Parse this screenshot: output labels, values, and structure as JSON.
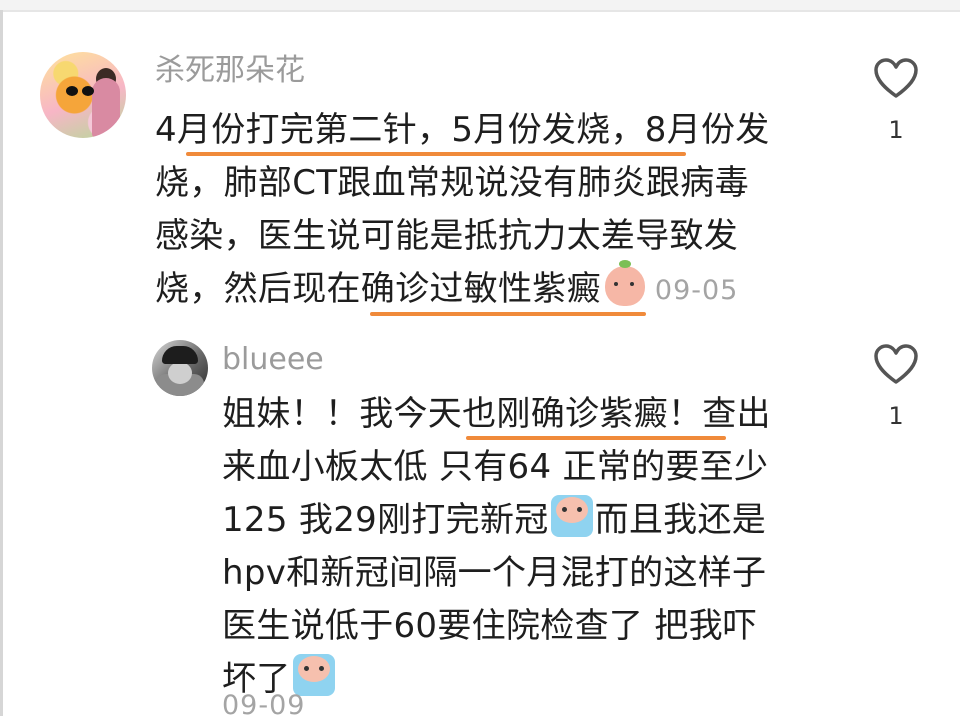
{
  "comments": [
    {
      "username": "杀死那朵花",
      "lines": [
        "4月份打完第二针，5月份发烧，8月份发",
        "烧，肺部CT跟血常规说没有肺炎跟病毒",
        "感染，医生说可能是抵抗力太差导致发",
        "烧，然后现在确诊过敏性紫癜"
      ],
      "date": "09-05",
      "likes": "1",
      "emoji": "peach"
    },
    {
      "username": "blueee",
      "lines": [
        "姐妹！！我今天也刚确诊紫癜！查出",
        "来血小板太低 只有64 正常的要至少",
        "125 我29刚打完新冠",
        "而且我还是",
        "hpv和新冠间隔一个月混打的这样子",
        "医生说低于60要住院检查了 把我吓",
        "坏了"
      ],
      "date": "09-09",
      "likes": "1",
      "emoji": "crying"
    }
  ],
  "icons": {
    "like": "heart-outline-icon"
  },
  "colors": {
    "underline": "#f08a3a",
    "username": "#9b9b9b",
    "date": "#a4a4a4"
  }
}
